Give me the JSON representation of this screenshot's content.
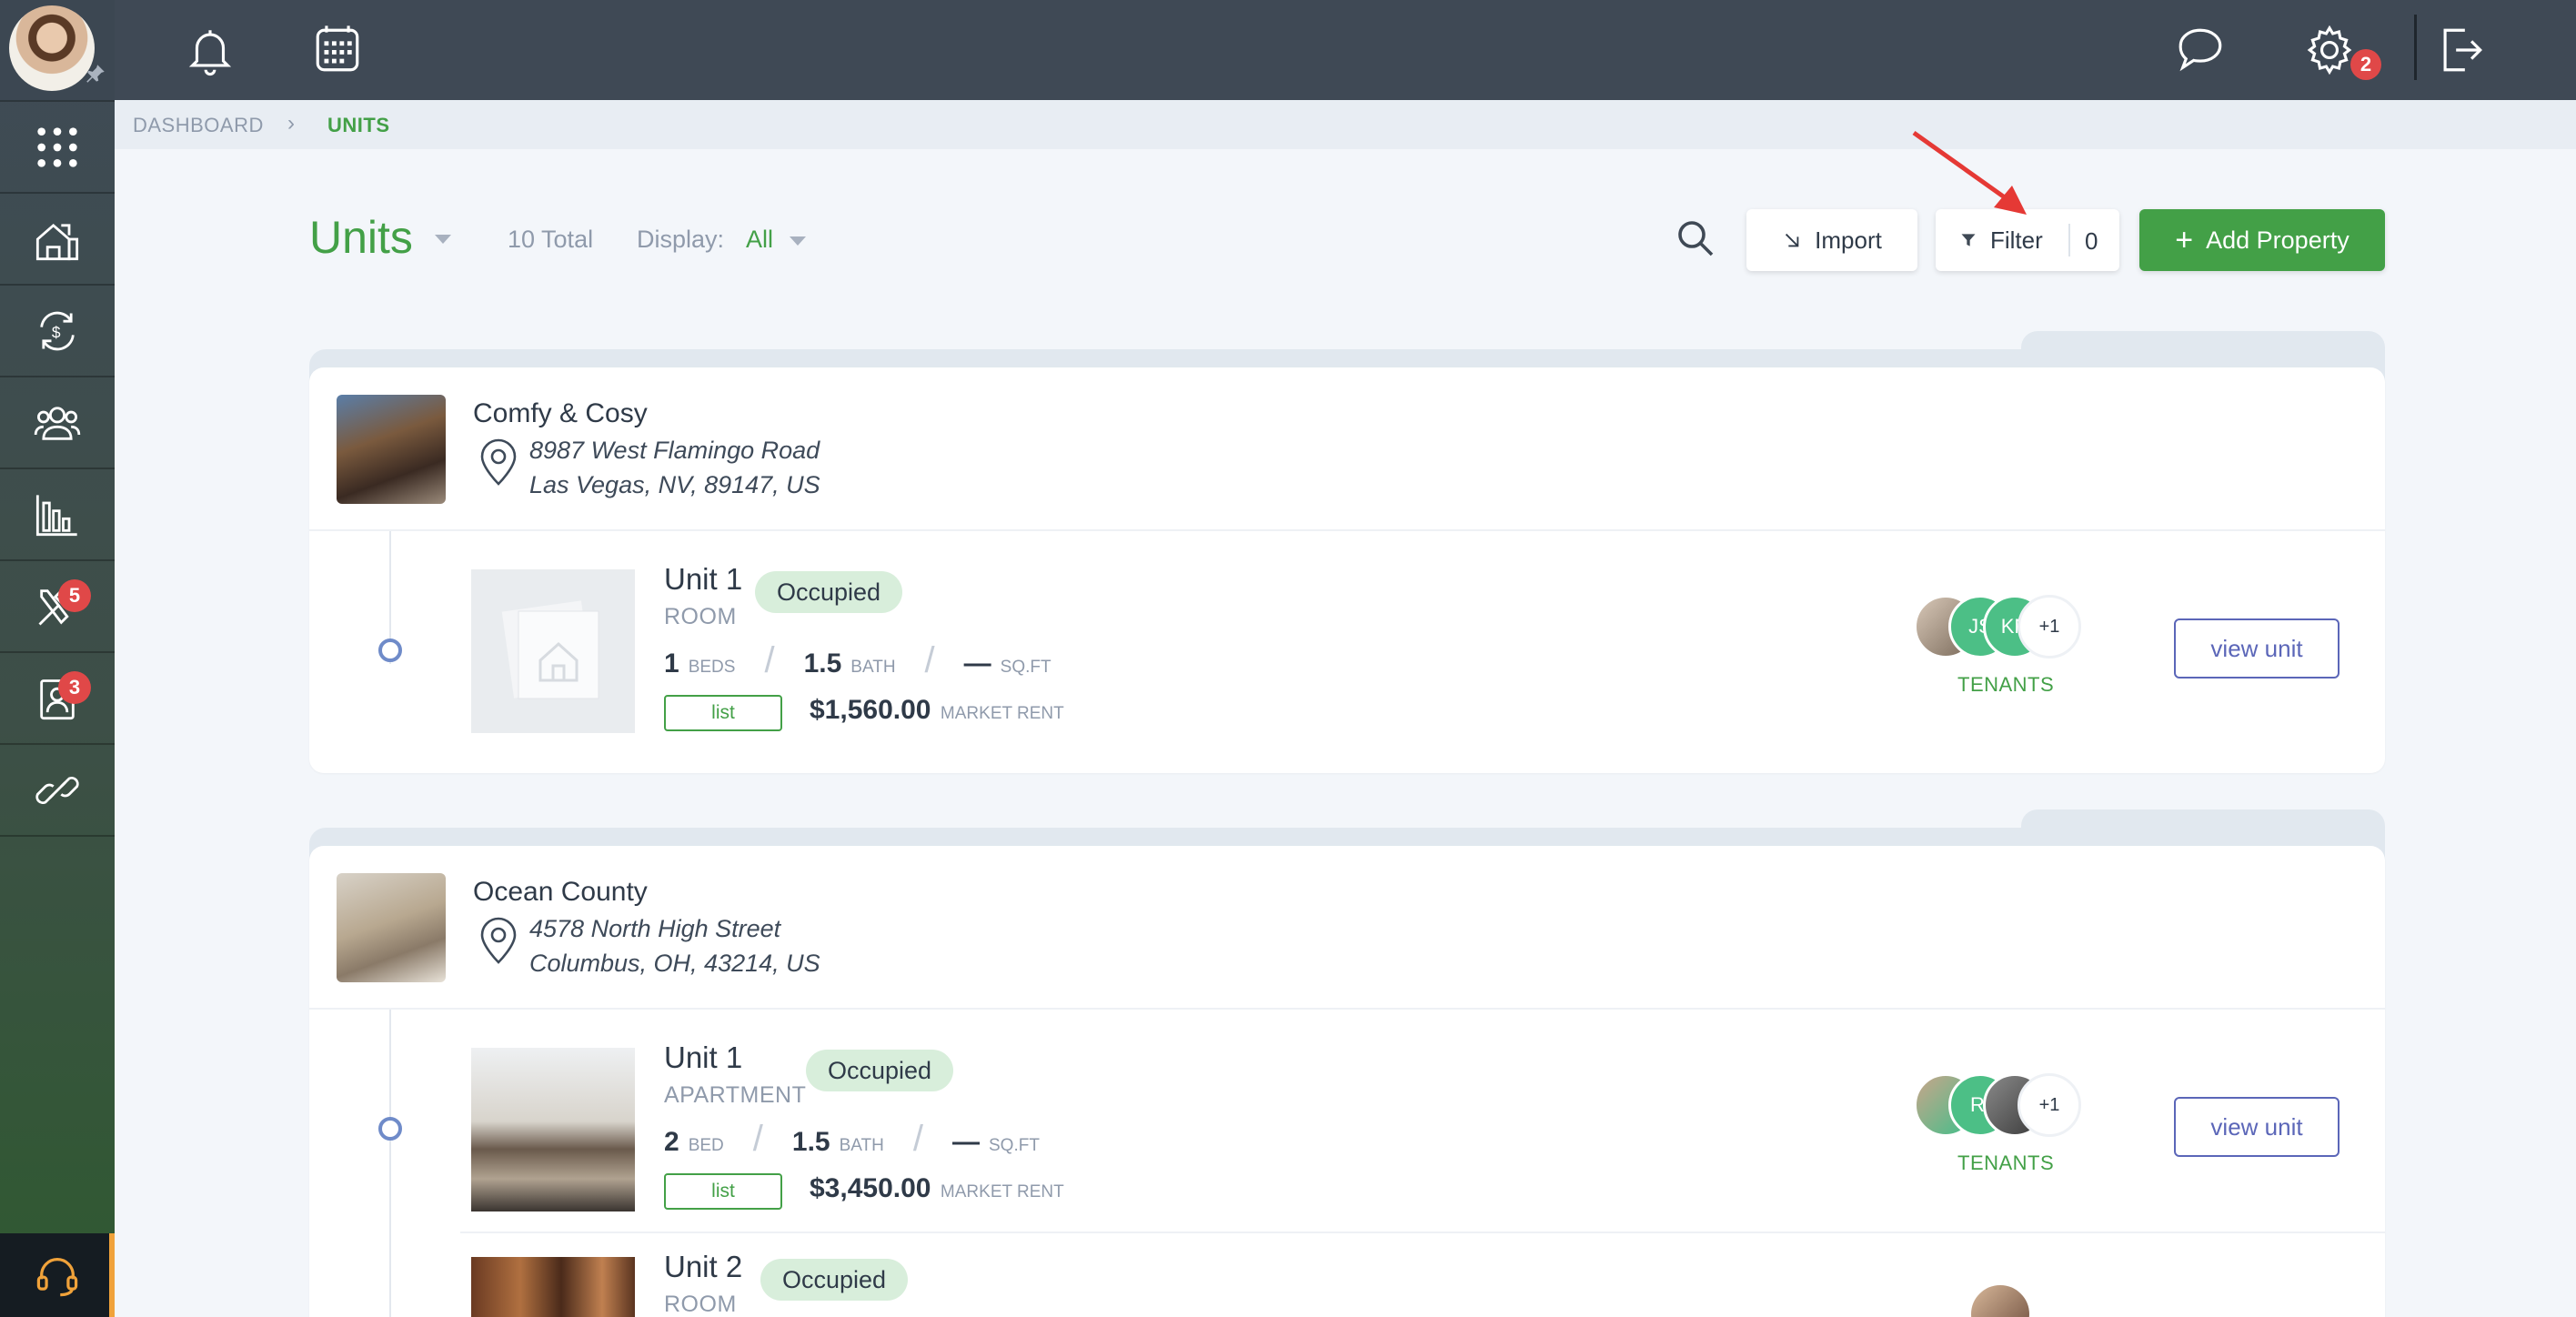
{
  "sidebar": {
    "items": [
      {
        "icon": "grid-apps-icon"
      },
      {
        "icon": "properties-icon"
      },
      {
        "icon": "payments-icon"
      },
      {
        "icon": "people-icon"
      },
      {
        "icon": "reports-chart-icon"
      },
      {
        "icon": "maintenance-tools-icon",
        "badge": "5"
      },
      {
        "icon": "applications-icon",
        "badge": "3"
      },
      {
        "icon": "link-icon"
      }
    ],
    "support_icon": "headset-icon"
  },
  "topbar": {
    "icons": [
      "bell-icon",
      "calendar-icon",
      "chat-icon",
      "gear-icon",
      "logout-icon"
    ],
    "chat_badge": "2"
  },
  "breadcrumb": {
    "home": "DASHBOARD",
    "current": "UNITS"
  },
  "header": {
    "title": "Units",
    "total": "10 Total",
    "display_label": "Display:",
    "display_value": "All",
    "import_label": "Import",
    "filter_label": "Filter",
    "filter_count": "0",
    "add_label": "Add Property"
  },
  "properties": [
    {
      "name": "Comfy & Cosy",
      "address_line1": "8987 West Flamingo Road",
      "address_line2": "Las Vegas, NV, 89147, US",
      "units": [
        {
          "name": "Unit 1",
          "status": "Occupied",
          "type": "ROOM",
          "beds": "1",
          "beds_label": "BEDS",
          "bath": "1.5",
          "bath_label": "BATH",
          "sqft": "—",
          "sqft_label": "SQ.FT",
          "list_label": "list",
          "rent": "$1,560.00",
          "rent_label": "MARKET RENT",
          "tenant_initials": [
            "JS",
            "KN"
          ],
          "tenant_more": "+1",
          "tenants_label": "TENANTS",
          "view_label": "view unit"
        }
      ]
    },
    {
      "name": "Ocean County",
      "address_line1": "4578 North High Street",
      "address_line2": "Columbus, OH, 43214, US",
      "units": [
        {
          "name": "Unit 1",
          "status": "Occupied",
          "type": "APARTMENT",
          "beds": "2",
          "beds_label": "BED",
          "bath": "1.5",
          "bath_label": "BATH",
          "sqft": "—",
          "sqft_label": "SQ.FT",
          "list_label": "list",
          "rent": "$3,450.00",
          "rent_label": "MARKET RENT",
          "tenant_initials": [
            "RI"
          ],
          "tenant_more": "+1",
          "tenants_label": "TENANTS",
          "view_label": "view unit"
        },
        {
          "name": "Unit 2",
          "status": "Occupied",
          "type": "ROOM"
        }
      ]
    }
  ],
  "colors": {
    "accent": "#43a047",
    "sidebar": "#3f4a56",
    "badge": "#e04848",
    "link": "#5b66b8"
  }
}
